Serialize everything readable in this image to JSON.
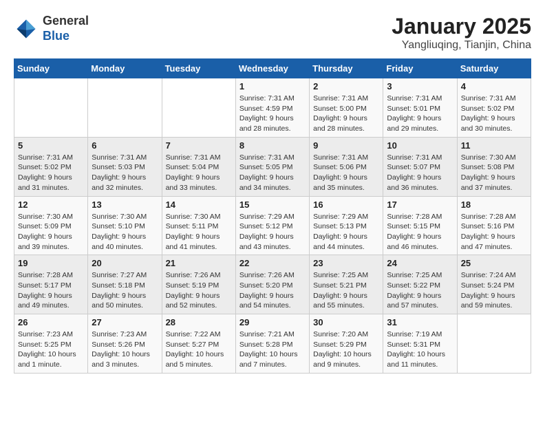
{
  "header": {
    "logo_general": "General",
    "logo_blue": "Blue",
    "month_year": "January 2025",
    "location": "Yangliuqing, Tianjin, China"
  },
  "weekdays": [
    "Sunday",
    "Monday",
    "Tuesday",
    "Wednesday",
    "Thursday",
    "Friday",
    "Saturday"
  ],
  "weeks": [
    [
      {
        "day": "",
        "info": ""
      },
      {
        "day": "",
        "info": ""
      },
      {
        "day": "",
        "info": ""
      },
      {
        "day": "1",
        "info": "Sunrise: 7:31 AM\nSunset: 4:59 PM\nDaylight: 9 hours\nand 28 minutes."
      },
      {
        "day": "2",
        "info": "Sunrise: 7:31 AM\nSunset: 5:00 PM\nDaylight: 9 hours\nand 28 minutes."
      },
      {
        "day": "3",
        "info": "Sunrise: 7:31 AM\nSunset: 5:01 PM\nDaylight: 9 hours\nand 29 minutes."
      },
      {
        "day": "4",
        "info": "Sunrise: 7:31 AM\nSunset: 5:02 PM\nDaylight: 9 hours\nand 30 minutes."
      }
    ],
    [
      {
        "day": "5",
        "info": "Sunrise: 7:31 AM\nSunset: 5:02 PM\nDaylight: 9 hours\nand 31 minutes."
      },
      {
        "day": "6",
        "info": "Sunrise: 7:31 AM\nSunset: 5:03 PM\nDaylight: 9 hours\nand 32 minutes."
      },
      {
        "day": "7",
        "info": "Sunrise: 7:31 AM\nSunset: 5:04 PM\nDaylight: 9 hours\nand 33 minutes."
      },
      {
        "day": "8",
        "info": "Sunrise: 7:31 AM\nSunset: 5:05 PM\nDaylight: 9 hours\nand 34 minutes."
      },
      {
        "day": "9",
        "info": "Sunrise: 7:31 AM\nSunset: 5:06 PM\nDaylight: 9 hours\nand 35 minutes."
      },
      {
        "day": "10",
        "info": "Sunrise: 7:31 AM\nSunset: 5:07 PM\nDaylight: 9 hours\nand 36 minutes."
      },
      {
        "day": "11",
        "info": "Sunrise: 7:30 AM\nSunset: 5:08 PM\nDaylight: 9 hours\nand 37 minutes."
      }
    ],
    [
      {
        "day": "12",
        "info": "Sunrise: 7:30 AM\nSunset: 5:09 PM\nDaylight: 9 hours\nand 39 minutes."
      },
      {
        "day": "13",
        "info": "Sunrise: 7:30 AM\nSunset: 5:10 PM\nDaylight: 9 hours\nand 40 minutes."
      },
      {
        "day": "14",
        "info": "Sunrise: 7:30 AM\nSunset: 5:11 PM\nDaylight: 9 hours\nand 41 minutes."
      },
      {
        "day": "15",
        "info": "Sunrise: 7:29 AM\nSunset: 5:12 PM\nDaylight: 9 hours\nand 43 minutes."
      },
      {
        "day": "16",
        "info": "Sunrise: 7:29 AM\nSunset: 5:13 PM\nDaylight: 9 hours\nand 44 minutes."
      },
      {
        "day": "17",
        "info": "Sunrise: 7:28 AM\nSunset: 5:15 PM\nDaylight: 9 hours\nand 46 minutes."
      },
      {
        "day": "18",
        "info": "Sunrise: 7:28 AM\nSunset: 5:16 PM\nDaylight: 9 hours\nand 47 minutes."
      }
    ],
    [
      {
        "day": "19",
        "info": "Sunrise: 7:28 AM\nSunset: 5:17 PM\nDaylight: 9 hours\nand 49 minutes."
      },
      {
        "day": "20",
        "info": "Sunrise: 7:27 AM\nSunset: 5:18 PM\nDaylight: 9 hours\nand 50 minutes."
      },
      {
        "day": "21",
        "info": "Sunrise: 7:26 AM\nSunset: 5:19 PM\nDaylight: 9 hours\nand 52 minutes."
      },
      {
        "day": "22",
        "info": "Sunrise: 7:26 AM\nSunset: 5:20 PM\nDaylight: 9 hours\nand 54 minutes."
      },
      {
        "day": "23",
        "info": "Sunrise: 7:25 AM\nSunset: 5:21 PM\nDaylight: 9 hours\nand 55 minutes."
      },
      {
        "day": "24",
        "info": "Sunrise: 7:25 AM\nSunset: 5:22 PM\nDaylight: 9 hours\nand 57 minutes."
      },
      {
        "day": "25",
        "info": "Sunrise: 7:24 AM\nSunset: 5:24 PM\nDaylight: 9 hours\nand 59 minutes."
      }
    ],
    [
      {
        "day": "26",
        "info": "Sunrise: 7:23 AM\nSunset: 5:25 PM\nDaylight: 10 hours\nand 1 minute."
      },
      {
        "day": "27",
        "info": "Sunrise: 7:23 AM\nSunset: 5:26 PM\nDaylight: 10 hours\nand 3 minutes."
      },
      {
        "day": "28",
        "info": "Sunrise: 7:22 AM\nSunset: 5:27 PM\nDaylight: 10 hours\nand 5 minutes."
      },
      {
        "day": "29",
        "info": "Sunrise: 7:21 AM\nSunset: 5:28 PM\nDaylight: 10 hours\nand 7 minutes."
      },
      {
        "day": "30",
        "info": "Sunrise: 7:20 AM\nSunset: 5:29 PM\nDaylight: 10 hours\nand 9 minutes."
      },
      {
        "day": "31",
        "info": "Sunrise: 7:19 AM\nSunset: 5:31 PM\nDaylight: 10 hours\nand 11 minutes."
      },
      {
        "day": "",
        "info": ""
      }
    ]
  ]
}
